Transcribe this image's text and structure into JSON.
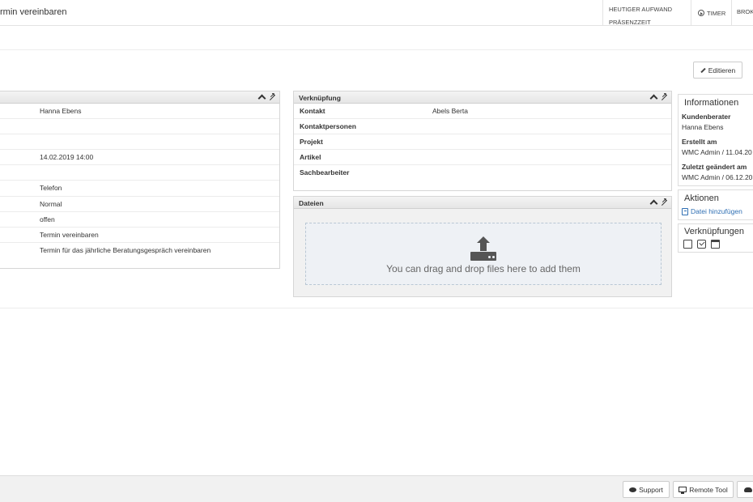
{
  "header": {
    "title": "rmin vereinbaren",
    "aufwand_label": "HEUTIGER AUFWAND",
    "praesenz_label": "PRÄSENZZEIT",
    "timer_label": "TIMER",
    "brok_label": "BROK"
  },
  "toolbar": {
    "edit_label": "Editieren"
  },
  "details": {
    "values": [
      "Hanna Ebens",
      "",
      "",
      "14.02.2019 14:00",
      "",
      "Telefon",
      "Normal",
      "offen",
      "Termin vereinbaren",
      "Termin für das jährliche Beratungsgespräch vereinbaren"
    ]
  },
  "verknuepfung": {
    "title": "Verknüpfung",
    "rows": [
      {
        "label": "Kontakt",
        "value": "Abels Berta"
      },
      {
        "label": "Kontaktpersonen",
        "value": ""
      },
      {
        "label": "Projekt",
        "value": ""
      },
      {
        "label": "Artikel",
        "value": ""
      },
      {
        "label": "Sachbearbeiter",
        "value": ""
      }
    ]
  },
  "dateien": {
    "title": "Dateien",
    "drop_text": "You can drag and drop files here to add them"
  },
  "sidebar": {
    "info_title": "Informationen",
    "kundenberater_label": "Kundenberater",
    "kundenberater_value": "Hanna Ebens",
    "erstellt_label": "Erstellt am",
    "erstellt_value": "WMC Admin / 11.04.20",
    "geaendert_label": "Zuletzt geändert am",
    "geaendert_value": "WMC Admin / 06.12.20",
    "aktionen_title": "Aktionen",
    "datei_link": "Datei hinzufügen",
    "verknuepfungen_title": "Verknüpfungen"
  },
  "footer": {
    "support_label": "Support",
    "remote_label": "Remote Tool"
  },
  "colors": {
    "link": "#2f6fb3",
    "panel_header": "#e6e6e6",
    "footer_bg": "#f1f1f1"
  }
}
